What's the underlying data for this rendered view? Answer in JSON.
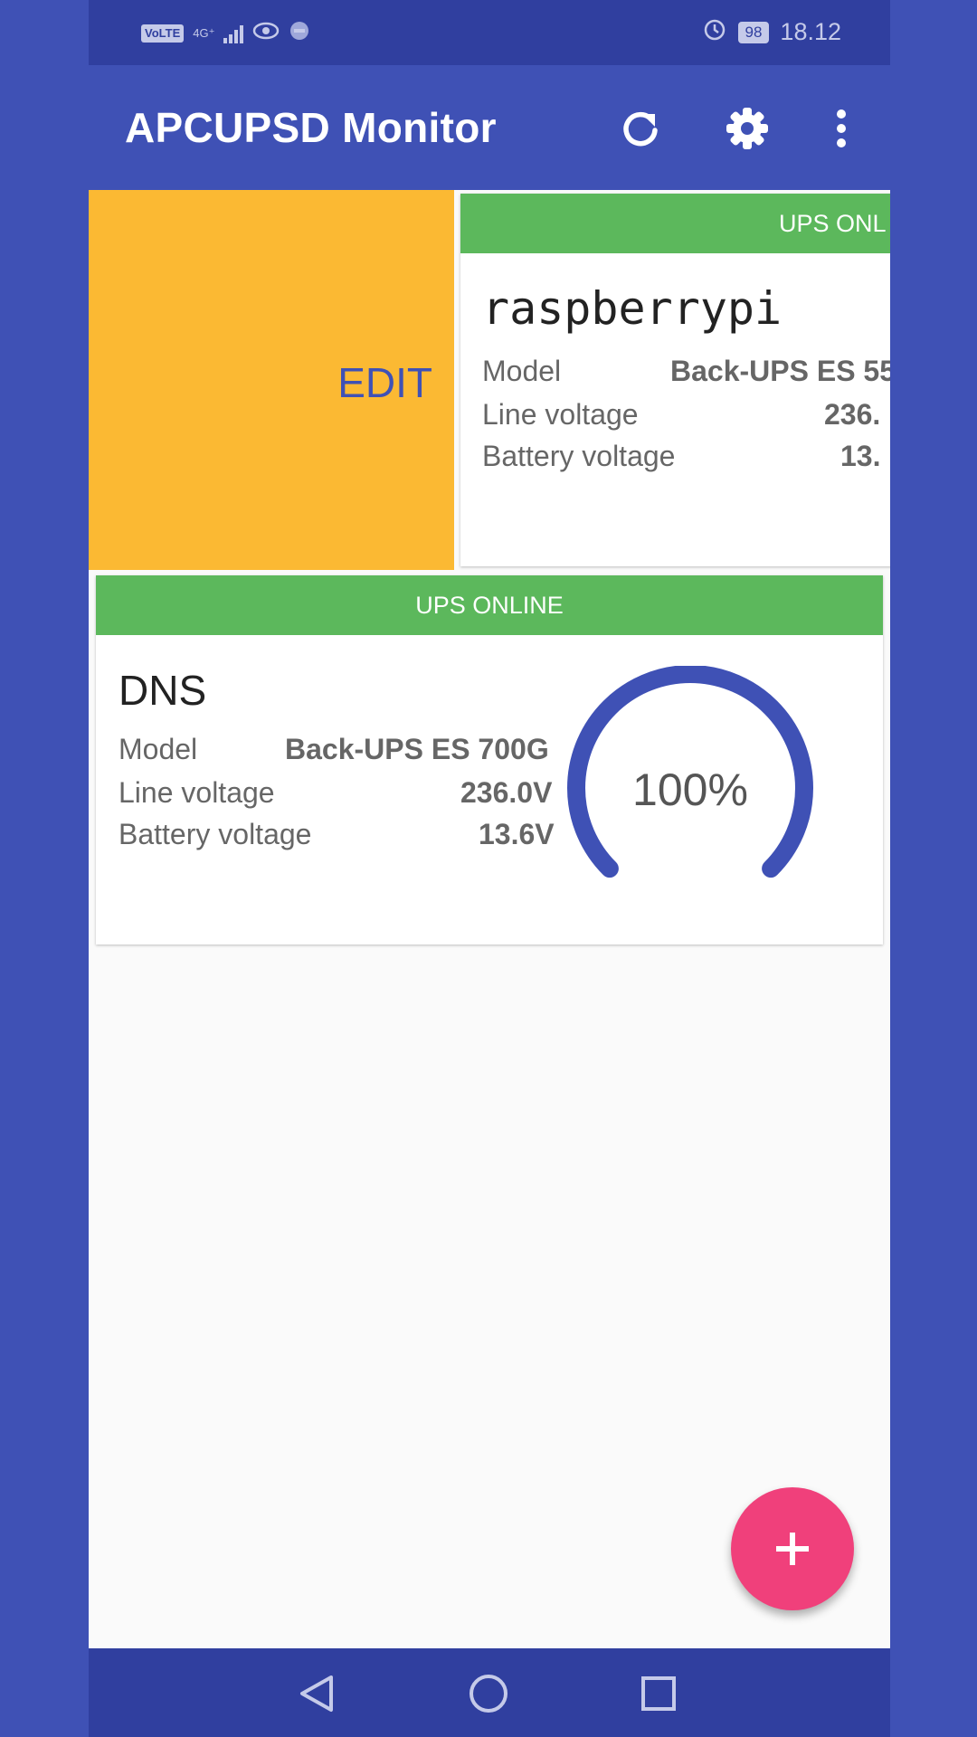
{
  "status_bar": {
    "volte": "VoLTE",
    "network": "4G⁺",
    "battery": "98",
    "time": "18.12"
  },
  "app_bar": {
    "title": "APCUPSD Monitor",
    "icons": [
      "refresh-icon",
      "settings-icon",
      "more-vert-icon"
    ]
  },
  "swipe": {
    "edit_label": "EDIT",
    "color": "#fbb933"
  },
  "devices": [
    {
      "status": "UPS ONLINE",
      "status_visible": "UPS ONL",
      "name": "raspberrypi",
      "labels": {
        "model": "Model",
        "line": "Line voltage",
        "battery": "Battery voltage"
      },
      "model": "Back-UPS ES 55",
      "line_voltage": "236.",
      "battery_voltage": "13."
    },
    {
      "status": "UPS ONLINE",
      "name": "DNS",
      "labels": {
        "model": "Model",
        "line": "Line voltage",
        "battery": "Battery voltage"
      },
      "model": "Back-UPS ES 700G",
      "line_voltage": "236.0V",
      "battery_voltage": "13.6V",
      "charge_label": "100%",
      "charge": 1.0
    }
  ],
  "fab": {
    "icon": "add-icon"
  },
  "nav_bar": {
    "icons": [
      "back-icon",
      "home-icon",
      "recents-icon"
    ]
  },
  "colors": {
    "primary": "#3f51b5",
    "primary_dark": "#303f9f",
    "online": "#5cb85c",
    "accent": "#f0407b",
    "gauge": "#3f51b5"
  }
}
